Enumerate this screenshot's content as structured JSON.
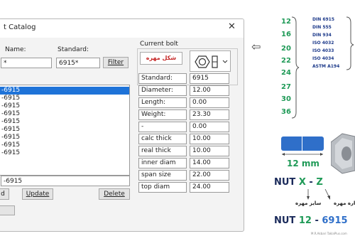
{
  "dialog": {
    "title": "t Catalog",
    "close_glyph": "✕",
    "name_label": "Name:",
    "standard_label": "Standard:",
    "name_value": "*",
    "standard_value": "6915*",
    "filter_label": "Filter",
    "current_bolt_label": "Current bolt",
    "bolt_tag": "شکل مهره",
    "list_items": [
      "-6915",
      "-6915",
      "-6915",
      "-6915",
      "-6915",
      "-6915",
      "-6915",
      "-6915",
      "-6915"
    ],
    "selected_index": 0,
    "bottom_name_value": "-6915",
    "add_label": "d",
    "update_label": "Update",
    "delete_label": "Delete",
    "properties": [
      {
        "label": "Standard:",
        "value": "6915"
      },
      {
        "label": "Diameter:",
        "value": "12.00"
      },
      {
        "label": "Length:",
        "value": "0.00"
      },
      {
        "label": "Weight:",
        "value": "23.30"
      },
      {
        "label": "-",
        "value": "0.00"
      },
      {
        "label": "calc thick",
        "value": "10.00"
      },
      {
        "label": "real thick",
        "value": "10.00"
      },
      {
        "label": "inner diam",
        "value": "14.00"
      },
      {
        "label": "span size",
        "value": "22.00"
      },
      {
        "label": "top diam",
        "value": "24.00"
      }
    ]
  },
  "graphic": {
    "arrow_glyph": "⇦",
    "sizes": [
      "12",
      "16",
      "20",
      "22",
      "24",
      "27",
      "30",
      "36"
    ],
    "standards": [
      "DIN 6915",
      "DIN 555",
      "DIN 934",
      "ISO 4032",
      "ISO 4033",
      "ISO 4034",
      "ASTM A194"
    ],
    "size_label": "12 mm",
    "nut_formula": {
      "prefix": "NUT ",
      "x": "X",
      "sep": " - ",
      "z": "Z"
    },
    "size_note": "سایز مهره",
    "number_note": "شماره مهره",
    "example": {
      "prefix": "NUT ",
      "size": "12",
      "sep": " - ",
      "standard": "6915"
    },
    "watermark": "M.R.Akbari   TaklaPlus.com"
  },
  "colors": {
    "accent_green": "#1f9a57",
    "standard_blue": "#1d3a8a",
    "bolt_tag_red": "#c62828",
    "nut_blue": "#2f6fc9",
    "select_blue": "#1e73d8"
  }
}
